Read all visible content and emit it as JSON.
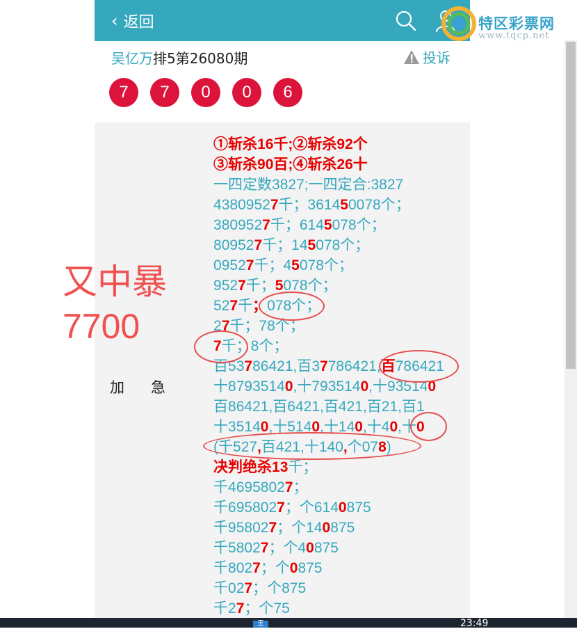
{
  "header": {
    "back_label": "返回"
  },
  "logo": {
    "name": "特区彩票网",
    "url": "www.tqcp.net"
  },
  "title": {
    "author": "吴亿万",
    "rest": "排5第26080期"
  },
  "report_label": "投诉",
  "balls": [
    "7",
    "7",
    "0",
    "0",
    "6"
  ],
  "side_text": {
    "line1": "又中暴",
    "line2": "7700"
  },
  "label": "加急",
  "content_lines": [
    {
      "text": "①斩杀16千;②斩杀92个",
      "headline": true
    },
    {
      "text": "③斩杀90百;④斩杀26十",
      "headline": true
    },
    {
      "text": "一四定数3827;一四定合:3827"
    },
    {
      "text": "43809527千；361450078个；",
      "red": [
        7,
        14
      ]
    },
    {
      "text": "3809527千；6145078个；",
      "red": [
        6,
        12
      ]
    },
    {
      "text": "809527千；145078个；",
      "red": [
        5,
        10
      ]
    },
    {
      "text": "09527千；45078个；",
      "red": [
        4,
        8
      ]
    },
    {
      "text": "9527千；5078个；",
      "red": [
        3,
        6
      ]
    },
    {
      "text": "527千；078个；",
      "red": [
        2,
        4
      ]
    },
    {
      "text": "27千；78个；",
      "red": [
        1
      ]
    },
    {
      "text": "7千；8个；",
      "red": [
        0
      ]
    },
    {
      "text": "百53786421,百37786421,百786421",
      "red": [
        3,
        12,
        20
      ]
    },
    {
      "text": "十87935140,十7935140,十935140",
      "red": [
        8,
        17,
        25
      ]
    },
    {
      "text": "百86421,百6421,百421,百21,百1"
    },
    {
      "text": "十35140,十5140,十140,十40,十0",
      "red": [
        5,
        11,
        16,
        20,
        23
      ]
    },
    {
      "text": "(千527,百421,十140,个078)",
      "red": [
        5,
        15,
        19
      ]
    },
    {
      "text": "决判绝杀13千；",
      "headline_part": 6
    },
    {
      "text": "千46958027；",
      "red": [
        8
      ]
    },
    {
      "text": "千6958027；个6140875",
      "red": [
        7,
        13
      ]
    },
    {
      "text": "千958027；个140875",
      "red": [
        6,
        11
      ]
    },
    {
      "text": "千58027；个40875",
      "red": [
        5,
        9
      ]
    },
    {
      "text": "千8027；个0875",
      "red": [
        4,
        7
      ]
    },
    {
      "text": "千027；个875",
      "red": [
        3
      ]
    },
    {
      "text": "千27；个75",
      "red": [
        2
      ]
    }
  ],
  "taskbar": {
    "ime": "王",
    "clock": "23:49"
  },
  "colors": {
    "header": "#35a8be",
    "ball": "#dc143c",
    "highlight": "#e60000",
    "side_text": "#f05050"
  }
}
